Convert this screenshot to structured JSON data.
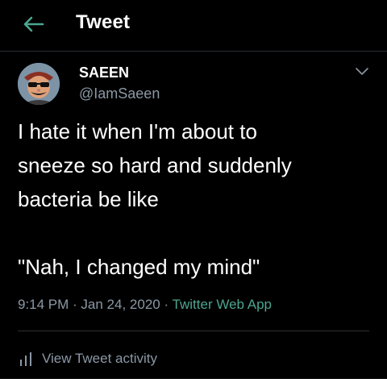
{
  "header": {
    "title": "Tweet",
    "back_icon": "arrow-left-icon"
  },
  "tweet": {
    "author": {
      "display_name": "SAEEN",
      "handle": "@IamSaeen"
    },
    "text_lines": [
      "I hate it when I'm about to",
      "sneeze so hard and suddenly",
      "bacteria be like",
      "\"Nah, I changed my mind\""
    ],
    "time": "9:14 PM",
    "separator": " · ",
    "date": "Jan 24, 2020",
    "source": "Twitter Web App"
  },
  "activity": {
    "label": "View Tweet activity",
    "icon": "bar-chart-icon"
  },
  "colors": {
    "background": "#000000",
    "accent": "#4ca58f",
    "secondary_text": "#8b98a5",
    "divider": "#2b2f33"
  }
}
